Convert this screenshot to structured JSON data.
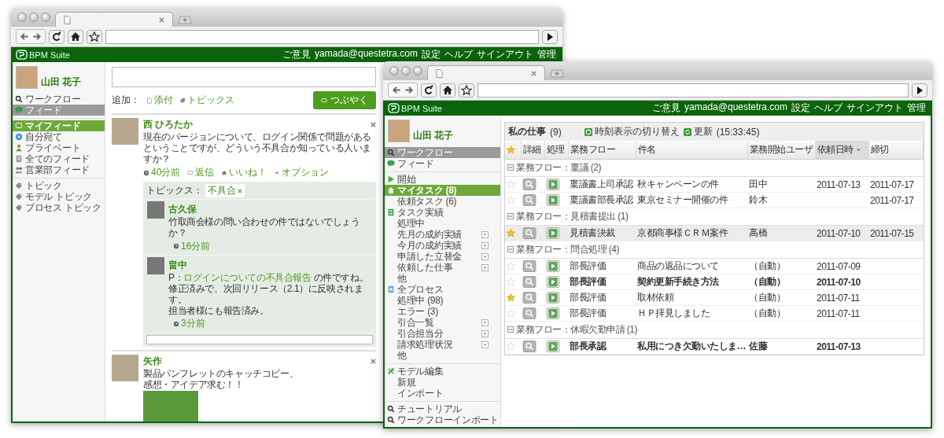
{
  "windows": [
    {
      "kind": "feed",
      "header": {
        "logo": "BPM Suite",
        "links": [
          "ご意見",
          "yamada@questetra.com",
          "設定",
          "ヘルプ",
          "サインアウト",
          "管理"
        ]
      },
      "user_name": "山田 花子",
      "nav": [
        [
          {
            "label": "ワークフロー",
            "kind": "search",
            "selected": false
          },
          {
            "label": "フィード",
            "kind": "chat",
            "selected": true
          }
        ],
        [
          {
            "label": "マイフィード",
            "kind": "feed",
            "selected": true
          },
          {
            "label": "自分宛て",
            "kind": "target",
            "selected": false
          },
          {
            "label": "プライベート",
            "kind": "person",
            "selected": false
          },
          {
            "label": "全てのフィード",
            "kind": "list",
            "selected": false
          },
          {
            "label": "営業部フィード",
            "kind": "group",
            "selected": false
          }
        ],
        [
          {
            "label": "トピック",
            "kind": "tag",
            "selected": false
          },
          {
            "label": "モデル トピック",
            "kind": "tag",
            "selected": false
          },
          {
            "label": "プロセス トピック",
            "kind": "tag",
            "selected": false
          }
        ]
      ],
      "composer": {
        "add_label": "追加：",
        "attach": "添付",
        "topics": "トピックス",
        "post_button": "つぶやく"
      },
      "posts": [
        {
          "author": "西 ひろたか",
          "lines": [
            "現在のバージョンについて、ログイン関係で問題があるということですが、どういう不具合か知っている人いますか？"
          ],
          "time": "40分前",
          "actions": [
            {
              "label": "返信",
              "kind": "reply"
            },
            {
              "label": "いいね！",
              "kind": "like"
            },
            {
              "label": "オプション",
              "kind": "options"
            }
          ],
          "topic_label": "トピックス：",
          "topic_tag": "不具合",
          "replies": [
            {
              "author": "古久保",
              "lines": [
                "竹取商会様の問い合わせの件ではないでしょうか？"
              ],
              "time": "16分前"
            },
            {
              "author": "畠中",
              "prefix": "P：",
              "link": "ログインについての不具合報告",
              "suffix": " の件ですね。",
              "lines": [
                "修正済みで、次回リリース（2.1）に反映されます。",
                "担当者様にも報告済み。"
              ],
              "time": "3分前"
            }
          ]
        },
        {
          "author": "矢作",
          "lines": [
            "製品パンフレットのキャッチコピー、",
            "感想・アイデア求む！！"
          ],
          "attachment": true
        }
      ]
    },
    {
      "kind": "tasks",
      "header": {
        "logo": "BPM Suite",
        "links": [
          "ご意見",
          "yamada@questetra.com",
          "設定",
          "ヘルプ",
          "サインアウト",
          "管理"
        ]
      },
      "user_name": "山田 花子",
      "nav": [
        [
          {
            "label": "ワークフロー",
            "kind": "search",
            "selected": true
          },
          {
            "label": "フィード",
            "kind": "chat",
            "selected": false
          }
        ],
        [
          {
            "label": "開始",
            "kind": "play",
            "selected": false,
            "dropdown": false
          },
          {
            "label": "マイタスク (8)",
            "kind": "home",
            "selected": true,
            "dropdown": false
          },
          {
            "label": "依頼タスク (6)",
            "kind": "sub",
            "selected": false,
            "dropdown": false
          },
          {
            "label": "タスク実績",
            "kind": "table",
            "selected": false,
            "dropdown": false
          },
          {
            "label": "処理中",
            "kind": "sub",
            "selected": false,
            "dropdown": false
          },
          {
            "label": "先月の成約実績",
            "kind": "sub",
            "selected": false,
            "dropdown": true
          },
          {
            "label": "今月の成約実績",
            "kind": "sub",
            "selected": false,
            "dropdown": true
          },
          {
            "label": "申請した立替金",
            "kind": "sub",
            "selected": false,
            "dropdown": true
          },
          {
            "label": "依頼した仕事",
            "kind": "sub",
            "selected": false,
            "dropdown": true
          },
          {
            "label": "他",
            "kind": "sub",
            "selected": false,
            "dropdown": false
          },
          {
            "label": "全プロセス",
            "kind": "globe",
            "selected": false,
            "dropdown": false
          },
          {
            "label": "処理中 (98)",
            "kind": "sub",
            "selected": false,
            "dropdown": false
          },
          {
            "label": "エラー (3)",
            "kind": "sub",
            "selected": false,
            "dropdown": false
          },
          {
            "label": "引合一覧",
            "kind": "sub",
            "selected": false,
            "dropdown": true
          },
          {
            "label": "引合担当分",
            "kind": "sub",
            "selected": false,
            "dropdown": true
          },
          {
            "label": "請求処理状況",
            "kind": "sub",
            "selected": false,
            "dropdown": true
          },
          {
            "label": "他",
            "kind": "sub",
            "selected": false,
            "dropdown": false
          }
        ],
        [
          {
            "label": "モデル編集",
            "kind": "tools",
            "selected": false
          },
          {
            "label": "新規",
            "kind": "sub",
            "selected": false
          },
          {
            "label": "インポート",
            "kind": "sub",
            "selected": false
          }
        ],
        [
          {
            "label": "チュートリアル",
            "kind": "search",
            "selected": false
          },
          {
            "label": "ワークフローインポート",
            "kind": "search",
            "selected": false
          }
        ]
      ],
      "panel": {
        "title": "私の仕事",
        "count": "(9)",
        "toggle": "時刻表示の切り替え",
        "refresh": "更新",
        "time": "(15:33:45)",
        "columns": [
          {
            "kind": "star",
            "sorted": false
          },
          {
            "label": "詳細",
            "sorted": false
          },
          {
            "label": "処理",
            "sorted": false
          },
          {
            "label": "業務フロー",
            "sorted": false
          },
          {
            "label": "件名",
            "sorted": false
          },
          {
            "label": "業務開始ユーザ",
            "sorted": false
          },
          {
            "label": "依頼日時",
            "sorted": true
          },
          {
            "label": "締切",
            "sorted": false
          }
        ],
        "groups": [
          {
            "title": "業務フロー：稟議 (2)",
            "expanded": true,
            "rows": [
              {
                "starred": false,
                "selected": false,
                "unread": false,
                "step": "稟議書上司承認",
                "subject": "秋キャンペーンの件",
                "user": "田中",
                "requested": "2011-07-13",
                "due": "2011-07-17"
              },
              {
                "starred": false,
                "selected": false,
                "unread": false,
                "step": "稟議書部長承認",
                "subject": "東京セミナー開催の件",
                "user": "鈴木",
                "due": "2011-07-17"
              }
            ]
          },
          {
            "title": "業務フロー：見積書提出 (1)",
            "expanded": true,
            "rows": [
              {
                "starred": true,
                "selected": true,
                "unread": false,
                "step": "見積書決裁",
                "subject": "京都商事様ＣＲＭ案件",
                "user": "高橋",
                "requested": "2011-07-10",
                "due": "2011-07-15"
              }
            ]
          },
          {
            "title": "業務フロー：問合処理 (4)",
            "expanded": true,
            "rows": [
              {
                "starred": false,
                "selected": false,
                "unread": false,
                "step": "部長評価",
                "subject": "商品の返品について",
                "user": "（自動）",
                "requested": "2011-07-09"
              },
              {
                "starred": false,
                "selected": false,
                "unread": true,
                "step": "部長評価",
                "subject": "契約更新手続き方法",
                "user": "（自動）",
                "requested": "2011-07-10"
              },
              {
                "starred": true,
                "selected": false,
                "unread": false,
                "step": "部長評価",
                "subject": "取材依頼",
                "user": "（自動）",
                "requested": "2011-07-11"
              },
              {
                "starred": false,
                "selected": false,
                "unread": false,
                "step": "部長評価",
                "subject": "ＨＰ拝見しました",
                "user": "（自動）",
                "requested": "2011-07-11"
              }
            ]
          },
          {
            "title": "業務フロー：休暇欠勤申請 (1)",
            "expanded": true,
            "rows": [
              {
                "starred": false,
                "selected": false,
                "unread": true,
                "step": "部長承認",
                "subject": "私用につき欠勤いたしま…",
                "user": "佐藤",
                "requested": "2011-07-13"
              }
            ]
          }
        ]
      }
    }
  ]
}
